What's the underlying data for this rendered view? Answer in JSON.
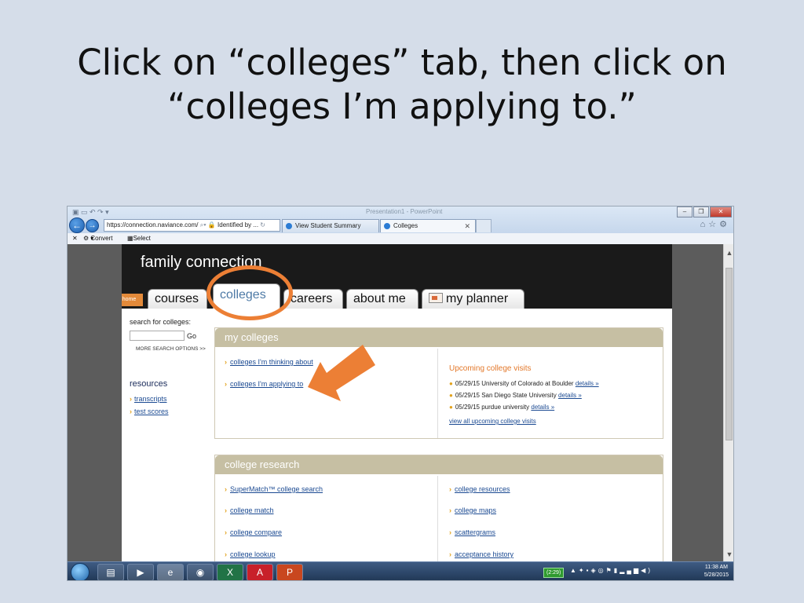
{
  "slide": {
    "title_line1": "Click on “colleges” tab, then click on",
    "title_line2": "“colleges I’m applying to.”"
  },
  "browser": {
    "app_title": "Presentation1 - PowerPoint",
    "address_url": "https://connection.naviance.com/",
    "address_identity": "Identified by ...",
    "tabs": [
      {
        "label": "View Student Summary",
        "active": false
      },
      {
        "label": "Colleges",
        "active": true
      }
    ],
    "cmdbar": {
      "convert": "Convert",
      "select": "Select"
    }
  },
  "site": {
    "title": "family connection",
    "home_tab": "home",
    "nav_tabs": {
      "courses": "courses",
      "colleges": "colleges",
      "careers": "careers",
      "about_me": "about me",
      "my_planner": "my planner"
    },
    "search": {
      "label": "search for colleges:",
      "go": "Go",
      "more": "MORE SEARCH OPTIONS >>"
    },
    "resources": {
      "heading": "resources",
      "links": [
        "transcripts",
        "test scores"
      ]
    },
    "my_colleges": {
      "heading": "my colleges",
      "links": [
        "colleges I'm thinking about",
        "colleges I'm applying to"
      ],
      "upcoming": {
        "heading": "Upcoming college visits",
        "visits": [
          {
            "text": "05/29/15 University of Colorado at Boulder",
            "details": "details »"
          },
          {
            "text": "05/29/15 San Diego State University",
            "details": "details »"
          },
          {
            "text": "05/29/15 purdue university",
            "details": "details »"
          }
        ],
        "view_all": "view all upcoming college visits"
      }
    },
    "college_research": {
      "heading": "college research",
      "left_links": [
        "SuperMatch™ college search",
        "college match",
        "college compare",
        "college lookup"
      ],
      "right_links": [
        "college resources",
        "college maps",
        "scattergrams",
        "acceptance history"
      ]
    }
  },
  "taskbar": {
    "tray_badge": "(2:29)",
    "time": "11:38 AM",
    "date": "5/28/2015"
  },
  "colors": {
    "annotation": "#ec7f35",
    "panel_header": "#c6bfa3",
    "link": "#1b4a92"
  }
}
